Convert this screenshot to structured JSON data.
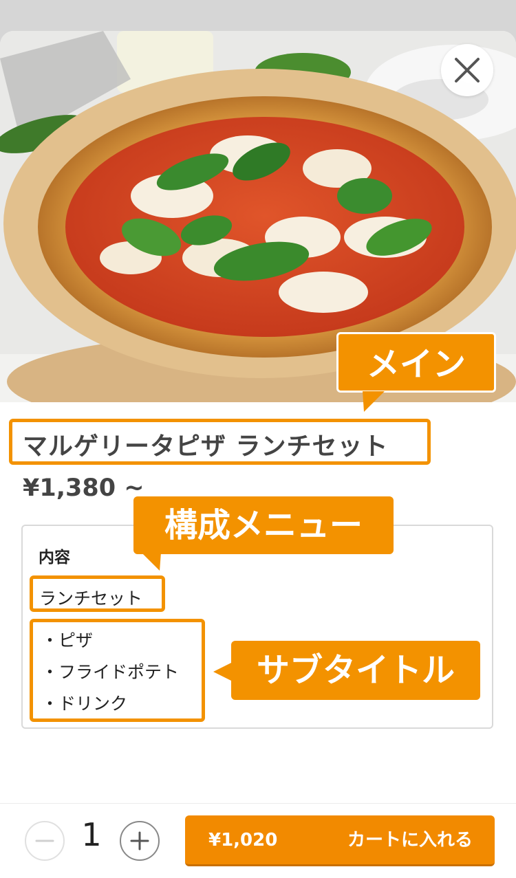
{
  "product": {
    "title": "マルゲリータピザ ランチセット",
    "price": "¥1,380 ~"
  },
  "contents": {
    "heading": "内容",
    "set_name": "ランチセット",
    "items": [
      "・ピザ",
      "・フライドポテト",
      "・ドリンク"
    ]
  },
  "annotations": {
    "main": "メイン",
    "composition": "構成メニュー",
    "subtitle": "サブタイトル"
  },
  "cart": {
    "quantity": "1",
    "price": "¥1,020",
    "add_label": "カートに入れる"
  },
  "colors": {
    "accent": "#f39200",
    "cart_button": "#f28a00"
  },
  "icons": {
    "close": "close-icon",
    "minus": "minus-icon",
    "plus": "plus-icon"
  }
}
